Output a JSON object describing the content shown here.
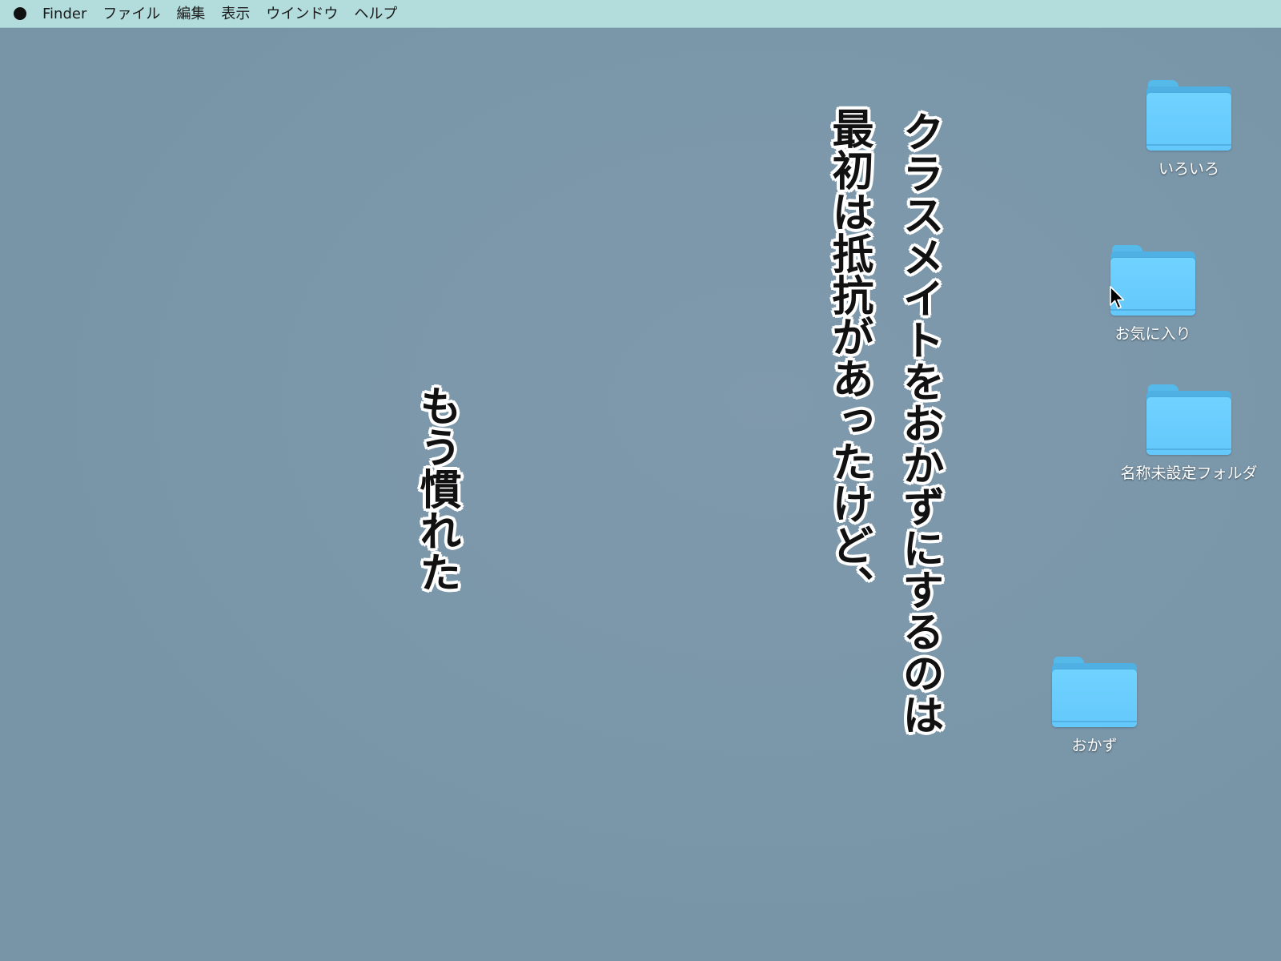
{
  "menubar": {
    "apple_icon": "apple-icon",
    "items": [
      "Finder",
      "ファイル",
      "編集",
      "表示",
      "ウインドウ",
      "ヘルプ"
    ]
  },
  "captions": [
    "クラスメイトをおかずにするのは",
    "最初は抵抗があったけど、",
    "もう慣れた"
  ],
  "folders": [
    {
      "label": "いろいろ",
      "icon": "folder-icon"
    },
    {
      "label": "お気に入り",
      "icon": "folder-icon"
    },
    {
      "label": "名称未設定フォルダ",
      "icon": "folder-icon"
    },
    {
      "label": "おかず",
      "icon": "folder-icon"
    }
  ],
  "colors": {
    "menubar": "#b3dcdc",
    "desktop": "#7895a8",
    "folder": "#64c8fb"
  }
}
